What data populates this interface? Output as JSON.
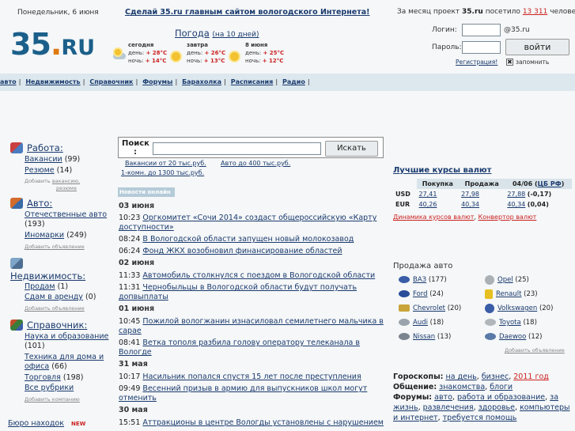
{
  "header": {
    "date": "Понедельник, 6 июня",
    "promo": "Сделай 35.ru главным сайтом вологодского Интернета!",
    "stats_prefix": "За месяц проект",
    "stats_site": "35.ru",
    "stats_mid": "посетило",
    "stats_count": "13 311",
    "stats_suffix": "человек",
    "logo_main": "35",
    "logo_dot": ".",
    "logo_ru": "RU"
  },
  "weather": {
    "title": "Погода",
    "title_link": "(на 10 дней)",
    "days": [
      {
        "name": "сегодня",
        "day_label": "день:",
        "day": "+ 28°С",
        "night_label": "ночь:",
        "night": "+ 14°С"
      },
      {
        "name": "завтра",
        "day_label": "день:",
        "day": "+ 26°С",
        "night_label": "ночь:",
        "night": "+ 13°С"
      },
      {
        "name": "8 июня",
        "day_label": "день:",
        "day": "+ 25°С",
        "night_label": "ночь:",
        "night": "+ 12°С"
      }
    ]
  },
  "login": {
    "login_label": "Логин:",
    "domain": "@35.ru",
    "password_label": "Пароль:",
    "submit": "войти",
    "register": "Регистрация!",
    "remember": "запомнить"
  },
  "nav": [
    "авто",
    "Недвижимость",
    "Справочник",
    "Форумы",
    "Барахолка",
    "Расписания",
    "Радио"
  ],
  "left": {
    "rabota": {
      "title": "Работа:",
      "items": [
        {
          "label": "Вакансии",
          "count": "(99)"
        },
        {
          "label": "Резюме",
          "count": "(14)"
        }
      ],
      "add_prefix": "Добавить",
      "add1": "вакансию,",
      "add2": "резюме"
    },
    "avto": {
      "title": "Авто:",
      "items": [
        {
          "label": "Отечественные авто",
          "count": "(193)"
        },
        {
          "label": "Иномарки",
          "count": "(249)"
        }
      ],
      "add": "Добавить объявление"
    },
    "nedv": {
      "title": "Недвижимость:",
      "items": [
        {
          "label": "Продам",
          "count": "(1)"
        },
        {
          "label": "Сдам в аренду",
          "count": "(0)"
        }
      ],
      "add": "Добавить объявление"
    },
    "sprav": {
      "title": "Справочник:",
      "items": [
        {
          "label": "Наука и образование",
          "count": "(101)"
        },
        {
          "label": "Техника для дома и офиса",
          "count": "(66)"
        },
        {
          "label": "Торговля",
          "count": "(198)"
        },
        {
          "label": "Все рубрики",
          "count": ""
        }
      ],
      "add": "Добавить компанию"
    },
    "buro": "Бюро находок",
    "new_badge": "NEW"
  },
  "search": {
    "label": "Поиск :",
    "button": "Искать",
    "hints": [
      "Вакансии от 20 тыс.руб.",
      "Авто до 400 тыс.руб.",
      "1-комн. до 1300 тыс.руб."
    ]
  },
  "news": {
    "tag": "Новости онлайн",
    "groups": [
      {
        "date": "03 июня",
        "items": [
          {
            "time": "10:23",
            "text": "Оргкомитет «Сочи 2014» создаст общероссийскую «Карту доступности»"
          },
          {
            "time": "08:24",
            "text": "В Вологодской области запущен новый молокозавод"
          },
          {
            "time": "06:24",
            "text": "Фонд ЖКХ возобновил финансирование областей"
          }
        ]
      },
      {
        "date": "02 июня",
        "items": [
          {
            "time": "11:33",
            "text": "Автомобиль столкнулся с поездом в Вологодской области"
          },
          {
            "time": "11:31",
            "text": "Чернобыльцы в Вологодской области будут получать допвыплаты"
          }
        ]
      },
      {
        "date": "01 июня",
        "items": [
          {
            "time": "10:45",
            "text": "Пожилой вологжанин изнасиловал семилетнего мальчика в сарае"
          },
          {
            "time": "08:41",
            "text": "Ветка тополя разбила голову оператору телеканала в Вологде"
          }
        ]
      },
      {
        "date": "31 мая",
        "items": [
          {
            "time": "10:17",
            "text": "Насильник попался спустя 15 лет после преступления"
          },
          {
            "time": "09:49",
            "text": "Весенний призыв в армию для выпускников школ могут отменить"
          }
        ]
      },
      {
        "date": "30 мая",
        "items": [
          {
            "time": "15:51",
            "text": "Аттракционы в центре Вологды установлены с нарушением"
          }
        ]
      }
    ]
  },
  "rates": {
    "title": "Лучшие курсы валют",
    "headers": [
      "Покупка",
      "Продажа",
      "04/06 (",
      "ЦБ РФ",
      ")"
    ],
    "rows": [
      {
        "cur": "USD",
        "buy": "27,41",
        "sell": "27,98",
        "cb": "27,88",
        "delta": "(-0,17)"
      },
      {
        "cur": "EUR",
        "buy": "40,26",
        "sell": "40,34",
        "cb": "40,34",
        "delta": "(0,04)"
      }
    ],
    "link1": "Динамика курсов валют",
    "link2": "Конвертор валют"
  },
  "cars": {
    "title": "Продажа авто",
    "left": [
      {
        "name": "ВАЗ",
        "count": "(177)"
      },
      {
        "name": "Ford",
        "count": "(24)"
      },
      {
        "name": "Chevrolet",
        "count": "(20)"
      },
      {
        "name": "Audi",
        "count": "(18)"
      },
      {
        "name": "Nissan",
        "count": "(13)"
      }
    ],
    "right": [
      {
        "name": "Opel",
        "count": "(25)"
      },
      {
        "name": "Renault",
        "count": "(23)"
      },
      {
        "name": "Volkswagen",
        "count": "(20)"
      },
      {
        "name": "Toyota",
        "count": "(18)"
      },
      {
        "name": "Daewoo",
        "count": "(12)"
      }
    ],
    "add": "Добавить объявление"
  },
  "bottom": {
    "horo_label": "Гороскопы:",
    "horo1": "на день",
    "horo2": "бизнес",
    "horo3": "2011 год",
    "obsh_label": "Общение:",
    "obsh1": "знакомства",
    "obsh2": "блоги",
    "forum_label": "Форумы:",
    "forums": [
      "авто",
      "работа и образование",
      "за жизнь",
      "развлечения",
      "здоровье",
      "компьютеры и интернет",
      "требуется помощь"
    ]
  },
  "colors": {
    "brand": "#1b5f8a",
    "accent": "#e07a10",
    "alert": "#cc2222",
    "navbar": "#dce8ee"
  }
}
